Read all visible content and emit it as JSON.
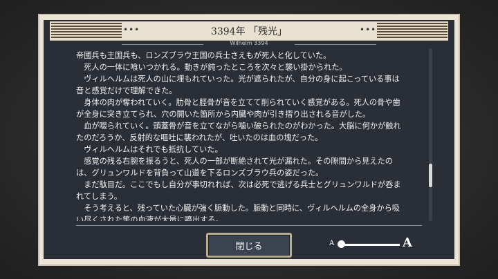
{
  "header": {
    "title": "3394年 「残光」",
    "subtitle": "Wilhelm 3394",
    "left_dots": "•••",
    "right_dots": "•••"
  },
  "story_lines": [
    "帝國兵も王国兵も、ロンズブラウ王国の兵士さえもが死人と化していた。",
    "　死人の一体に喰いつかれる。動きが鈍ったところを次々と襲い掛かられた。",
    "　ヴィルヘルムは死人の山に埋もれていった。光が遮られたが、自分の身に起こっている事は",
    "音と感覚だけで理解できた。",
    "　身体の肉が奪われていく。肋骨と脛骨が音を立てて削られていく感覚がある。死人の骨や歯",
    "が全身に突き立てられ、穴の開いた箇所から内臓や肉が引き摺り出される音がした。",
    "　血が啜られていく。頭蓋骨が音を立てながら噛い破られたのがわかった。大脳に何かが触れ",
    "たのだろうか、反射的な嘔吐に襲われたが、吐いたのは血の塊だった。",
    "　ヴィルヘルムはそれでも抵抗していた。",
    "　感覚の残る右腕を振るうと、死人の一部が断絶されて光が漏れた。その隙間から見えたの",
    "は、グリュンワルドを背負って山道を下るロンズブラウ兵の姿だった。",
    "　まだ駄目だ。ここでもし自分が事切れれば、次は必死で逃げる兵士とグリュンワルドが呑ま",
    "れてしまう。",
    "　そう考えると、残っていた心臓が強く脈動した。脈動と同時に、ヴィルヘルムの全身から吸",
    "い尽くされた筈の血液が大量に噴出する。"
  ],
  "buttons": {
    "close_label": "閉じる"
  },
  "font_size": {
    "small_label": "A",
    "large_label": "A",
    "level": 0.0
  },
  "scroll": {
    "position": 0.68
  },
  "colors": {
    "panel_bg": "#2a2e36",
    "frame": "#ece5d6",
    "stripe": "#5b4a35",
    "button_bg": "#3b4250",
    "button_border": "#b9ab8e"
  }
}
